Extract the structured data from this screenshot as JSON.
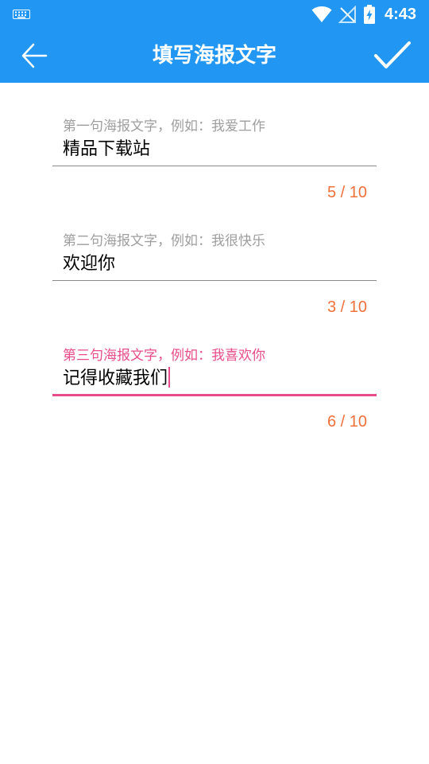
{
  "status_bar": {
    "time": "4:43",
    "icons": [
      "keyboard-icon",
      "wifi-icon",
      "no-signal-icon",
      "battery-charging-icon"
    ]
  },
  "app_bar": {
    "title": "填写海报文字",
    "back_icon": "arrow-left-icon",
    "confirm_icon": "check-icon",
    "background_color": "#2196F3"
  },
  "fields": [
    {
      "hint": "第一句海报文字，例如：我爱工作",
      "value": "精品下载站",
      "counter": "5 / 10",
      "focused": false
    },
    {
      "hint": "第二句海报文字，例如：我很快乐",
      "value": "欢迎你",
      "counter": "3 / 10",
      "focused": false
    },
    {
      "hint": "第三句海报文字，例如：我喜欢你",
      "value": "记得收藏我们",
      "counter": "6 / 10",
      "focused": true
    }
  ],
  "colors": {
    "accent": "#E84C8B",
    "counter": "#F0703A",
    "hint": "#9E9E9E"
  }
}
